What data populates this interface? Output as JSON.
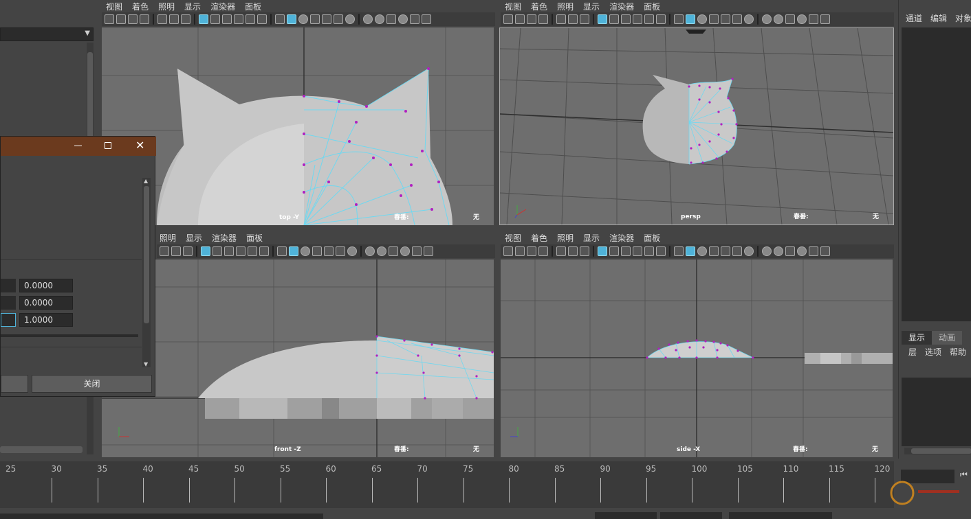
{
  "viewport_menu": [
    "视图",
    "着色",
    "照明",
    "显示",
    "渲染器",
    "面板"
  ],
  "viewport_menu_bottom_left": [
    "照明",
    "显示",
    "渲染器",
    "面板"
  ],
  "viewports": {
    "top": {
      "name": "top -Y",
      "camera_label": "春番:",
      "none_label": "无"
    },
    "persp": {
      "name": "persp",
      "camera_label": "春番:",
      "none_label": "无"
    },
    "front": {
      "name": "front -Z",
      "camera_label": "春番:",
      "none_label": "无"
    },
    "side": {
      "name": "side -X",
      "camera_label": "春番:",
      "none_label": "无"
    }
  },
  "right_panel": {
    "top_menu": [
      "通道",
      "编辑",
      "对象"
    ],
    "tabs": [
      "显示",
      "动画"
    ],
    "menu": [
      "层",
      "选项",
      "帮助"
    ]
  },
  "dialog": {
    "fields": [
      "0.0000",
      "0.0000",
      "1.0000"
    ],
    "close_label": "关闭"
  },
  "timeline": {
    "ticks": [
      "25",
      "30",
      "35",
      "40",
      "45",
      "50",
      "55",
      "60",
      "65",
      "70",
      "75",
      "80",
      "85",
      "90",
      "95",
      "100",
      "105",
      "110",
      "115",
      "120"
    ]
  },
  "icons": [
    "minimize-icon",
    "maximize-icon",
    "close-icon",
    "dropdown-icon"
  ],
  "colors": {
    "wire": "#6fd8f0",
    "vertex": "#b020c0",
    "viewport_bg": "#6e6e6e",
    "dialog_title": "#6b3a1e"
  }
}
